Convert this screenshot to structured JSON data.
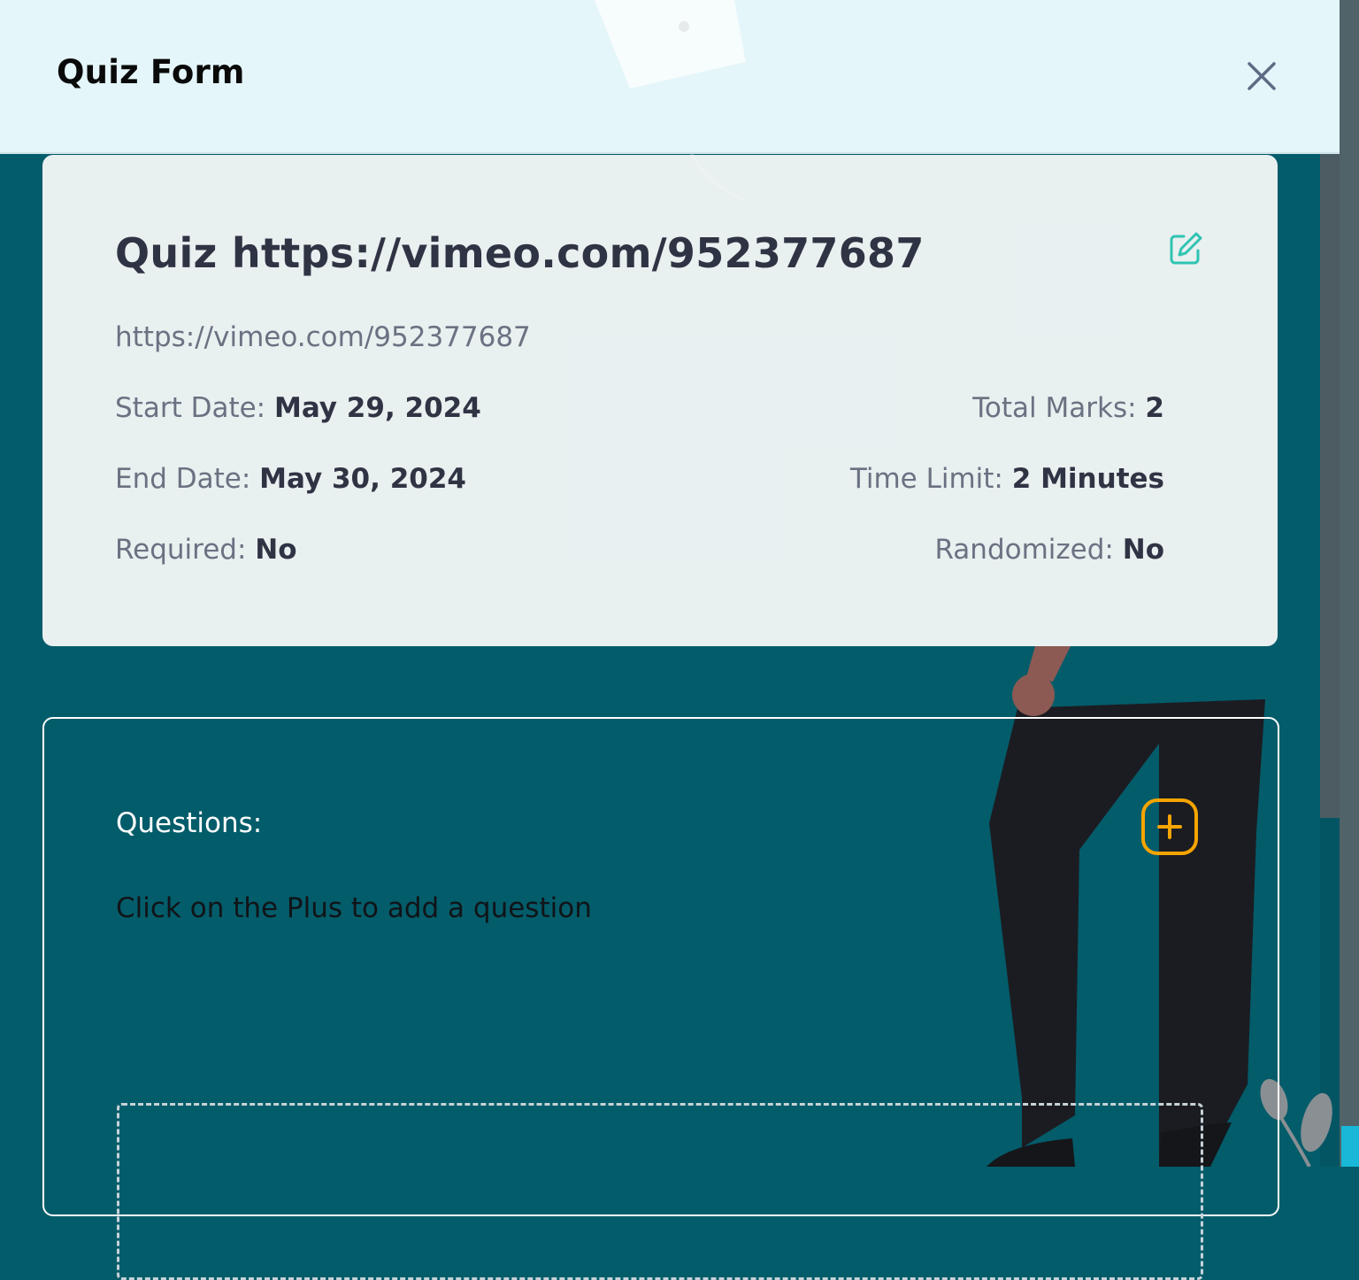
{
  "modal": {
    "title": "Quiz Form",
    "close_icon": "close-icon"
  },
  "quiz": {
    "title": "Quiz https://vimeo.com/952377687",
    "link": "https://vimeo.com/952377687",
    "edit_icon": "edit-icon",
    "start_date_label": "Start Date:",
    "start_date": "May 29, 2024",
    "end_date_label": "End Date:",
    "end_date": "May 30, 2024",
    "required_label": "Required:",
    "required": "No",
    "total_marks_label": "Total Marks:",
    "total_marks": "2",
    "time_limit_label": "Time Limit:",
    "time_limit": "2 Minutes",
    "randomized_label": "Randomized:",
    "randomized": "No"
  },
  "questions": {
    "label": "Questions:",
    "hint": "Click on the Plus to add a question",
    "add_icon": "plus-icon"
  },
  "colors": {
    "background": "#035c6a",
    "header": "#e4f6f9",
    "accent_add": "#f5a400",
    "accent_edit": "#2fc4b2"
  }
}
